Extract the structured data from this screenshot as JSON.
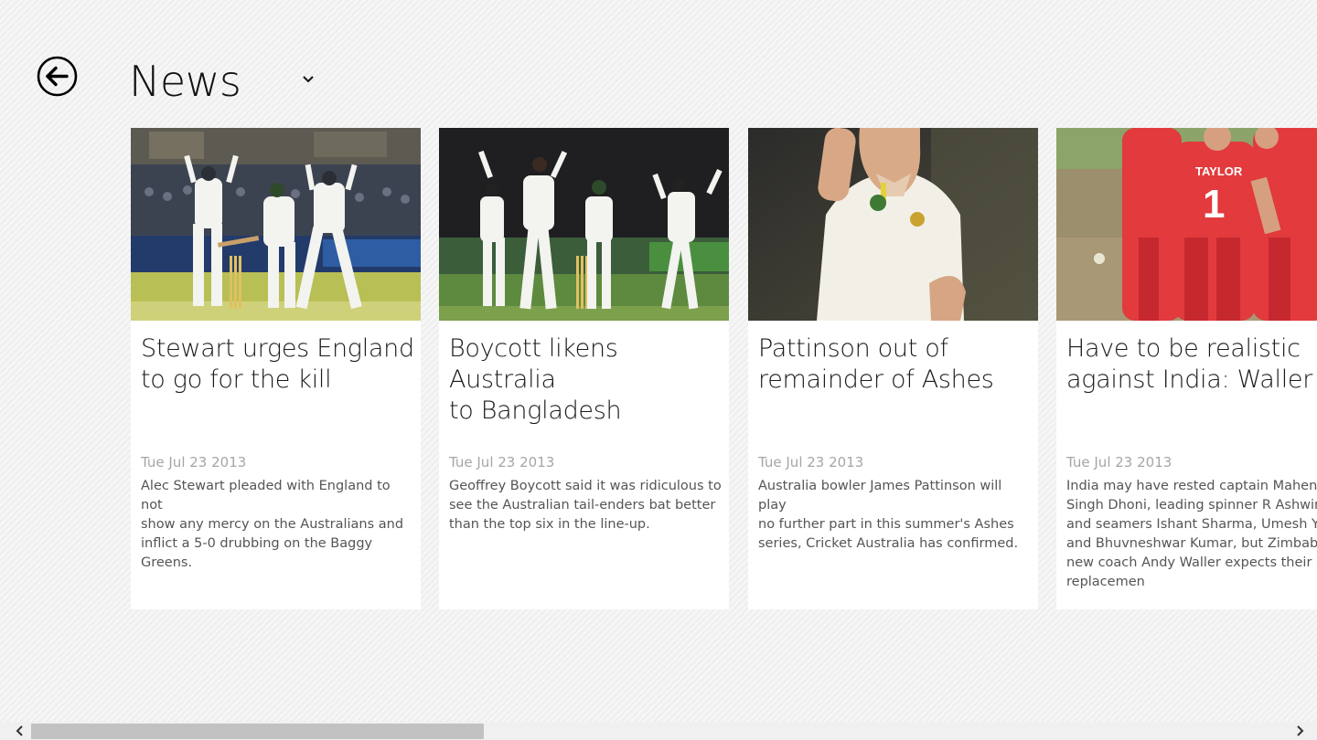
{
  "header": {
    "title": "News",
    "back_icon": "arrow-left-circle-icon",
    "dropdown_icon": "chevron-down-icon"
  },
  "cards": [
    {
      "title": "Stewart urges England\nto go for the kill",
      "date": "Tue Jul 23 2013",
      "summary": "Alec Stewart pleaded with England to not\nshow any mercy on the Australians and\ninflict a 5-0 drubbing on the Baggy\nGreens."
    },
    {
      "title": "Boycott likens Australia\nto Bangladesh",
      "date": "Tue Jul 23 2013",
      "summary": "Geoffrey Boycott said it was ridiculous to\nsee the Australian tail-enders bat better\nthan the top six in the line-up."
    },
    {
      "title": "Pattinson out of\nremainder of Ashes",
      "date": "Tue Jul 23 2013",
      "summary": "Australia bowler James Pattinson will play\nno further part in this summer's Ashes\nseries, Cricket Australia has confirmed."
    },
    {
      "title": "Have to be realistic\nagainst India: Waller",
      "date": "Tue Jul 23 2013",
      "summary": "India may have rested captain Mahendra\nSingh Dhoni, leading spinner R Ashwin\nand seamers Ishant Sharma, Umesh Yadav\nand Bhuvneshwar Kumar, but Zimbabwe's\nnew coach Andy Waller expects their\nreplacemen",
      "jersey_name": "TAYLOR",
      "jersey_number": "1"
    }
  ],
  "scrollbar": {
    "left_icon": "chevron-left-icon",
    "right_icon": "chevron-right-icon"
  },
  "colors": {
    "background": "#f4f4f4",
    "card_background": "#ffffff",
    "scroll_thumb": "#c2c2c2",
    "date_text": "#a6a6a6"
  }
}
